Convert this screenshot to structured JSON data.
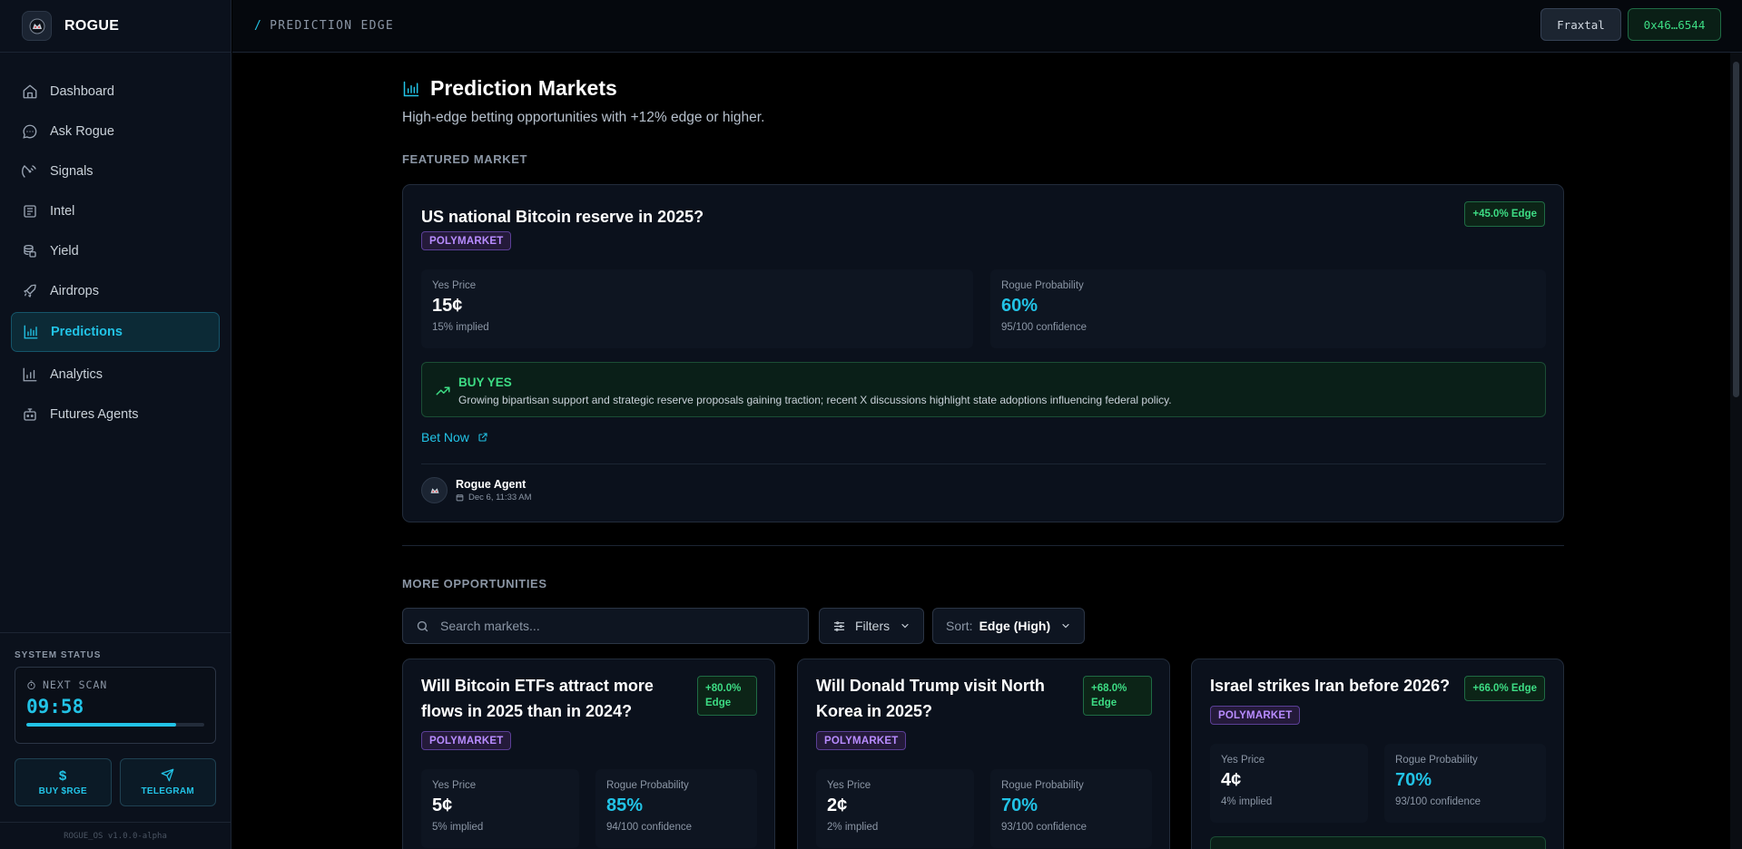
{
  "app": {
    "name": "ROGUE"
  },
  "breadcrumb": {
    "slash": "/",
    "label": "PREDICTION EDGE"
  },
  "topbar": {
    "user_label": "Fraxtal",
    "wallet_label": "0x46…6544"
  },
  "sidebar": {
    "items": [
      {
        "label": "Dashboard",
        "icon": "home-icon"
      },
      {
        "label": "Ask Rogue",
        "icon": "chat-icon"
      },
      {
        "label": "Signals",
        "icon": "radar-icon"
      },
      {
        "label": "Intel",
        "icon": "newspaper-icon"
      },
      {
        "label": "Yield",
        "icon": "coins-icon"
      },
      {
        "label": "Airdrops",
        "icon": "rocket-icon"
      },
      {
        "label": "Predictions",
        "icon": "chart-icon",
        "active": true
      },
      {
        "label": "Analytics",
        "icon": "bar-chart-icon"
      },
      {
        "label": "Futures Agents",
        "icon": "bot-icon"
      }
    ],
    "system_status": {
      "label": "SYSTEM STATUS",
      "next_scan_label": "NEXT SCAN",
      "next_scan_time": "09:58",
      "progress": 0.84
    },
    "buttons": {
      "buy": "BUY $RGE",
      "buy_icon": "$",
      "telegram": "TELEGRAM"
    },
    "version": "ROGUE_OS v1.0.0-alpha"
  },
  "page": {
    "title": "Prediction Markets",
    "subtitle": "High-edge betting opportunities with +12% edge or higher.",
    "featured_label": "FEATURED MARKET",
    "more_label": "MORE OPPORTUNITIES"
  },
  "featured": {
    "title": "US national Bitcoin reserve in 2025?",
    "source": "POLYMARKET",
    "edge": "+45.0% Edge",
    "yes_price_label": "Yes Price",
    "yes_price": "15¢",
    "yes_implied": "15% implied",
    "prob_label": "Rogue Probability",
    "prob": "60%",
    "confidence": "95/100 confidence",
    "rec_title": "BUY YES",
    "rec_text": "Growing bipartisan support and strategic reserve proposals gaining traction; recent X discussions highlight state adoptions influencing federal policy.",
    "bet_label": "Bet Now",
    "agent_name": "Rogue Agent",
    "agent_date": "Dec 6, 11:33 AM"
  },
  "controls": {
    "search_placeholder": "Search markets...",
    "filters_label": "Filters",
    "sort_label": "Sort:",
    "sort_value": "Edge (High)"
  },
  "markets": [
    {
      "title": "Will Bitcoin ETFs attract more flows in 2025 than in 2024?",
      "source": "POLYMARKET",
      "edge_value": "+80.0%",
      "edge_word": "Edge",
      "yes_price_label": "Yes Price",
      "yes_price": "5¢",
      "yes_implied": "5% implied",
      "prob_label": "Rogue Probability",
      "prob": "85%",
      "confidence": "94/100 confidence"
    },
    {
      "title": "Will Donald Trump visit North Korea in 2025?",
      "source": "POLYMARKET",
      "edge_value": "+68.0%",
      "edge_word": "Edge",
      "yes_price_label": "Yes Price",
      "yes_price": "2¢",
      "yes_implied": "2% implied",
      "prob_label": "Rogue Probability",
      "prob": "70%",
      "confidence": "93/100 confidence"
    },
    {
      "title": "Israel strikes Iran before 2026?",
      "source": "POLYMARKET",
      "edge": "+66.0% Edge",
      "yes_price_label": "Yes Price",
      "yes_price": "4¢",
      "yes_implied": "4% implied",
      "prob_label": "Rogue Probability",
      "prob": "70%",
      "confidence": "93/100 confidence"
    }
  ]
}
